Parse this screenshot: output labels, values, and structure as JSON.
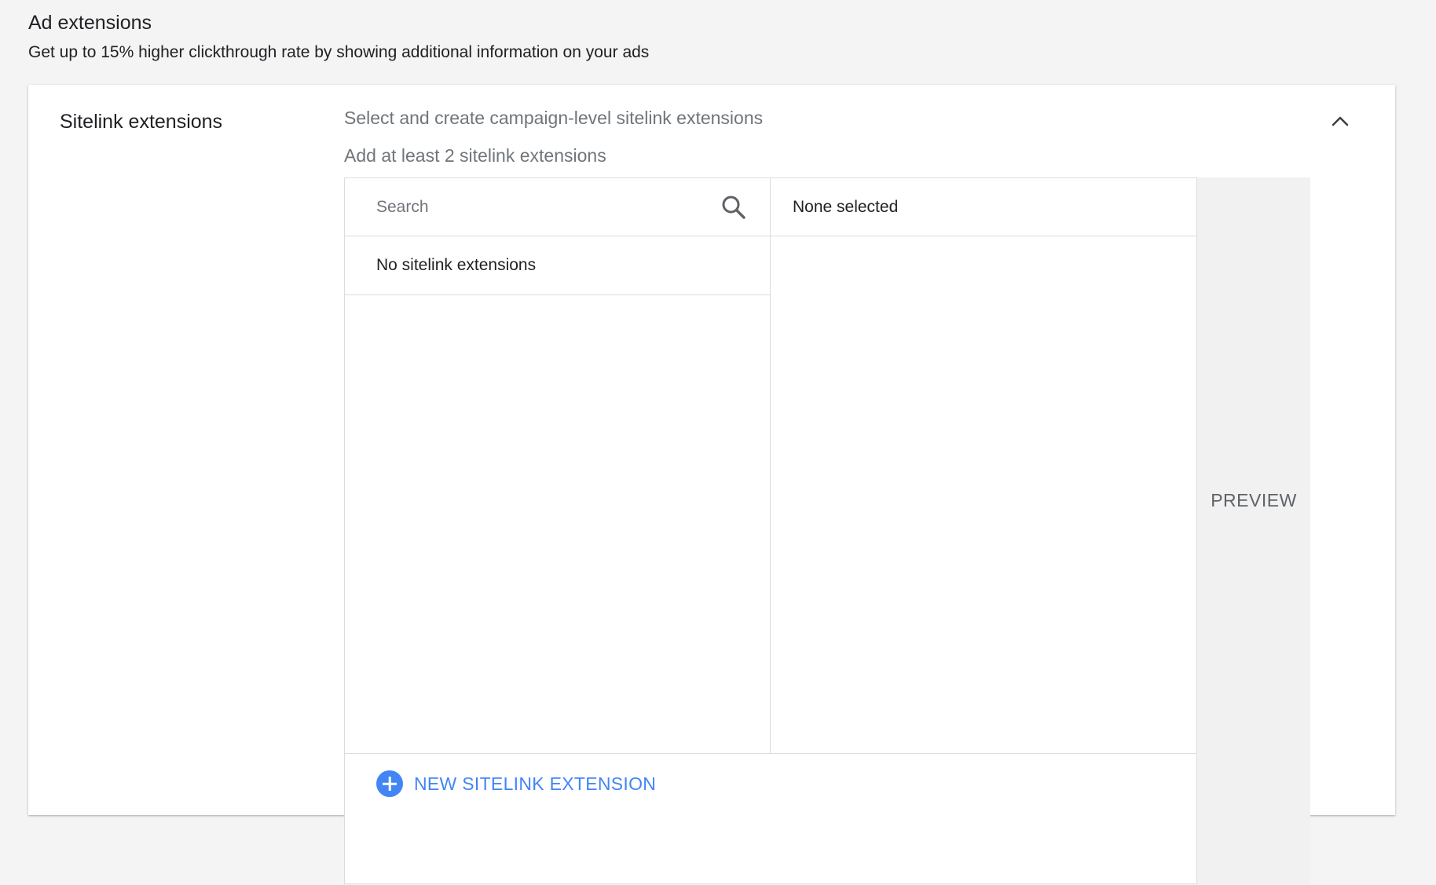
{
  "header": {
    "title": "Ad extensions",
    "subtitle": "Get up to 15% higher clickthrough rate by showing additional information on your ads"
  },
  "sitelinks": {
    "label": "Sitelink extensions",
    "instruction": "Select and create campaign-level sitelink extensions",
    "requirement": "Add at least 2 sitelink extensions",
    "collapse_icon": "chevron-up-icon",
    "search": {
      "placeholder": "Search",
      "value": "",
      "icon": "search-icon"
    },
    "available_empty": "No sitelink extensions",
    "selected_label": "None selected",
    "new_button": {
      "label": "NEW SITELINK EXTENSION",
      "icon": "add-circle-icon"
    },
    "preview_label": "PREVIEW"
  },
  "colors": {
    "accent": "#4285f4",
    "border": "#dadce0",
    "page_background": "#f4f4f4",
    "muted_text": "#70757a"
  }
}
